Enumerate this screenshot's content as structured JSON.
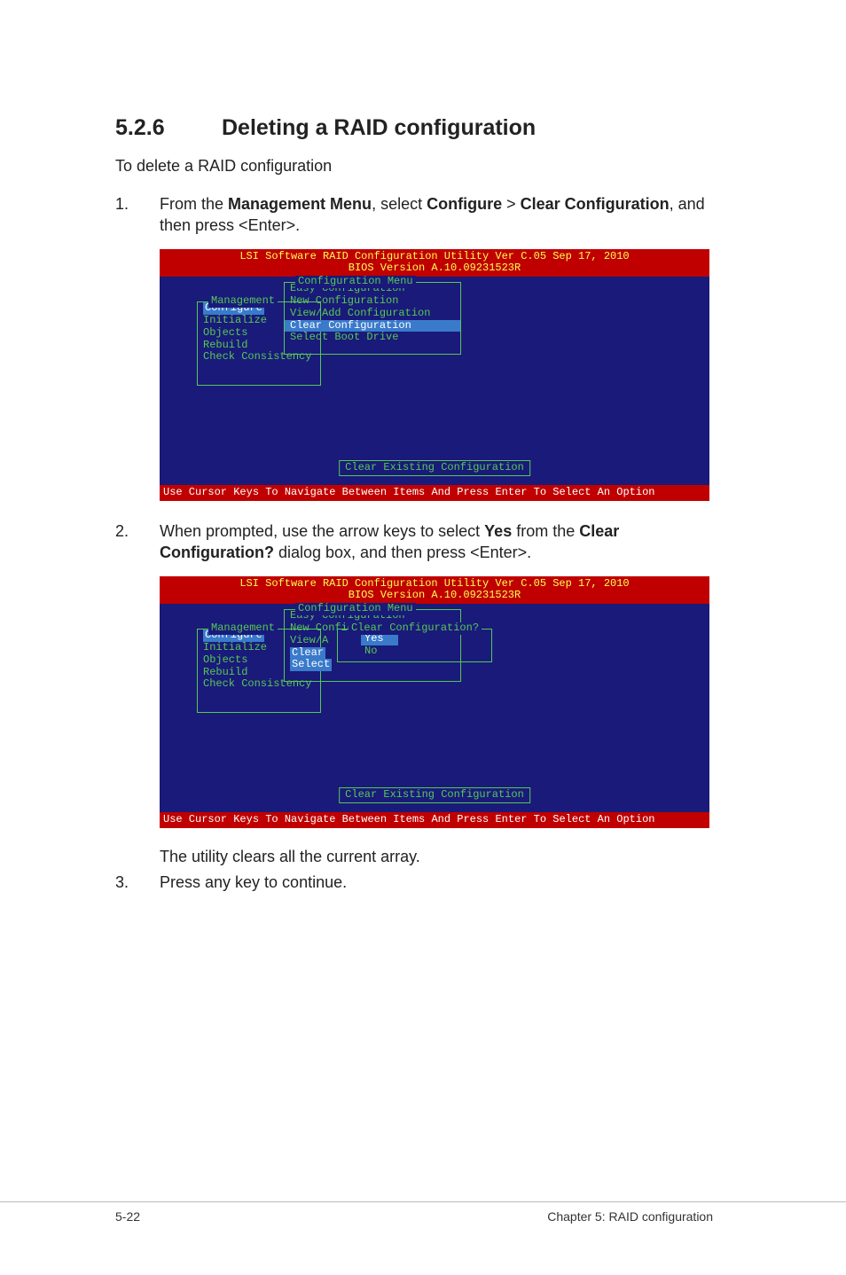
{
  "heading": {
    "number": "5.2.6",
    "title": "Deleting a RAID configuration"
  },
  "lead": "To delete a RAID configuration",
  "steps": {
    "s1": {
      "n": "1.",
      "prefix": "From the ",
      "b1": "Management Menu",
      "mid1": ", select ",
      "b2": "Configure",
      "mid2": " > ",
      "b3": "Clear Configuration",
      "suffix": ", and then press <Enter>."
    },
    "s2": {
      "n": "2.",
      "prefix": "When prompted, use the arrow keys to select ",
      "b1": "Yes",
      "mid1": " from the ",
      "b2": "Clear Configuration?",
      "suffix": " dialog box, and then press <Enter>."
    },
    "after2": "The utility clears all the current array.",
    "s3": {
      "n": "3.",
      "text": "Press any key to continue."
    }
  },
  "bios": {
    "header_line1": "LSI Software RAID Configuration Utility Ver C.05 Sep 17, 2010",
    "header_line2": "BIOS Version   A.10.09231523R",
    "footer": "Use Cursor Keys To Navigate Between Items And Press Enter To Select An Option",
    "mgmt_title": "Management",
    "mgmt_items": [
      "Configure",
      "Initialize",
      "Objects",
      "Rebuild",
      "Check Consistency"
    ],
    "cfg_title": "Configuration Menu",
    "cfg_items": [
      "Easy Configuration",
      "New Configuration",
      "View/Add Configuration",
      "Clear Configuration",
      "Select Boot Drive"
    ],
    "desc": "Clear Existing Configuration",
    "cfg_trunc": {
      "view": "View/A",
      "clear": "Clear",
      "select": "Select"
    },
    "clearq_title": "Clear Configuration?",
    "clearq_yes": "Yes",
    "clearq_no": "No"
  },
  "page_footer": {
    "left": "5-22",
    "right": "Chapter 5: RAID configuration"
  }
}
